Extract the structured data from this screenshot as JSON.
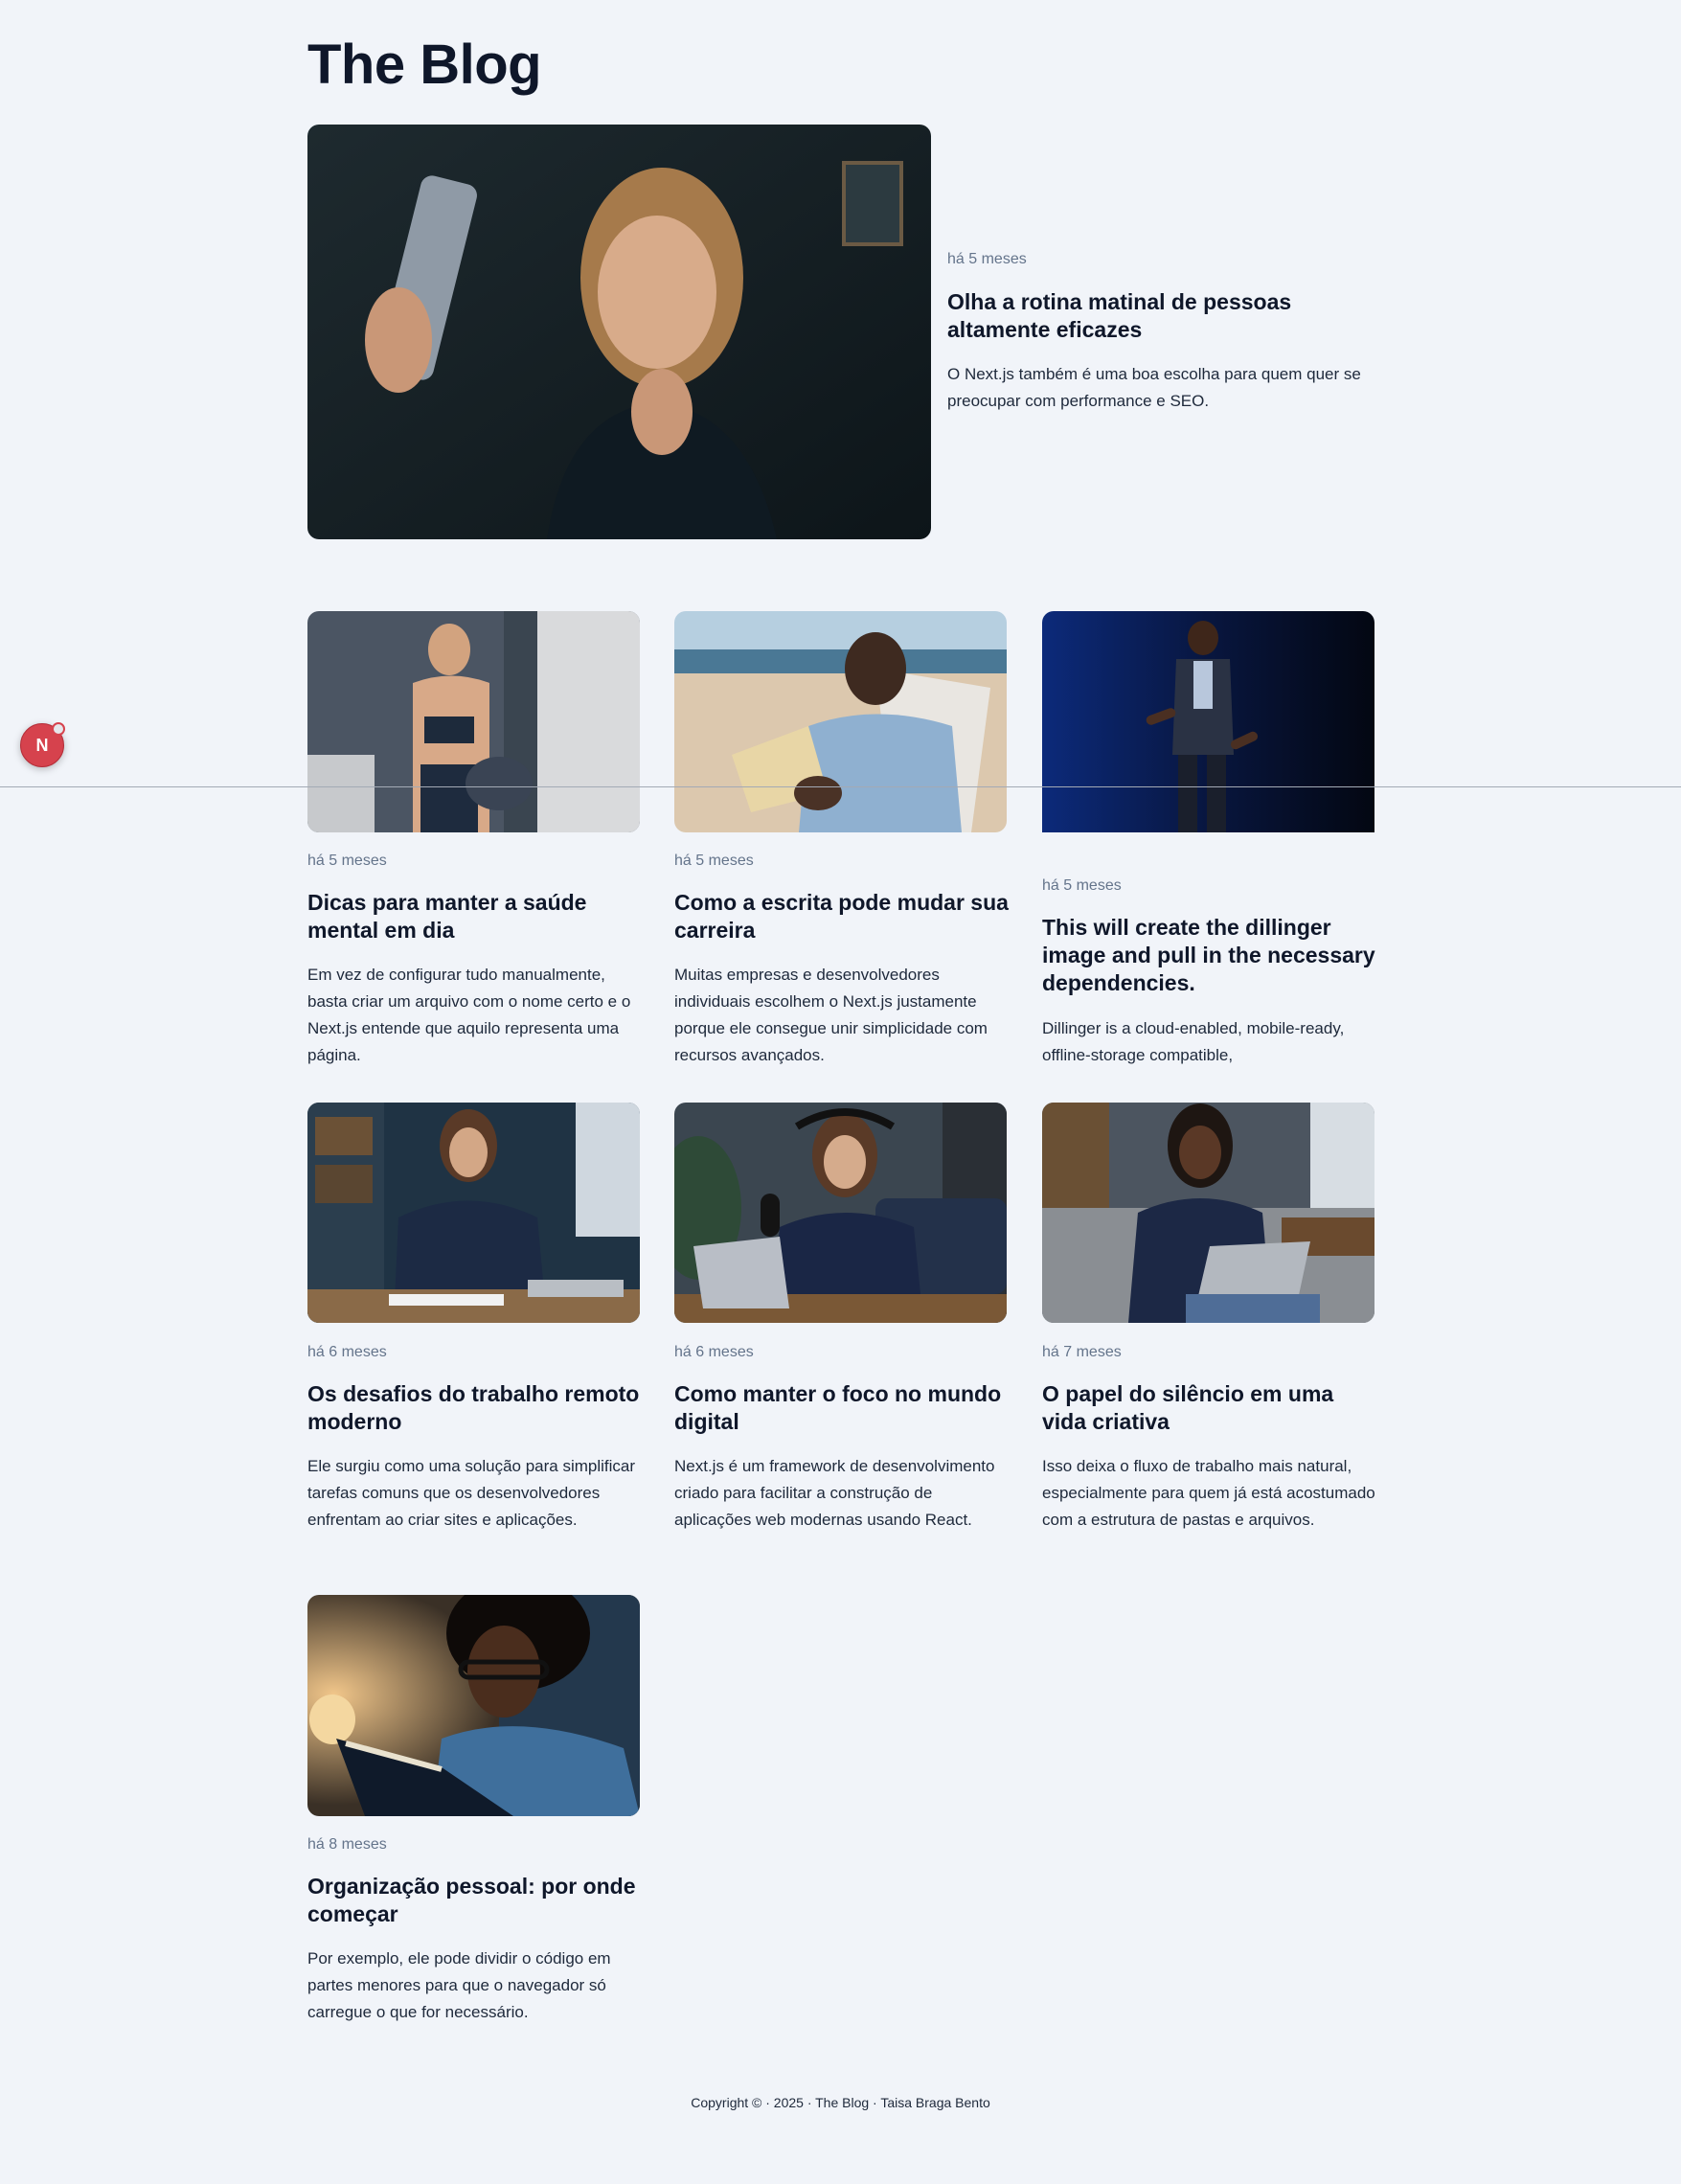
{
  "site": {
    "title": "The Blog"
  },
  "featured": {
    "time": "há 5 meses",
    "title": "Olha a rotina matinal de pessoas altamente eficazes",
    "excerpt": "O Next.js também é uma boa escolha para quem quer se preocupar com performance e SEO."
  },
  "posts": [
    {
      "time": "há 5 meses",
      "title": "Dicas para manter a saúde mental em dia",
      "excerpt": "Em vez de configurar tudo manualmente, basta criar um arquivo com o nome certo e o Next.js entende que aquilo representa uma página."
    },
    {
      "time": "há 5 meses",
      "title": "Como a escrita pode mudar sua carreira",
      "excerpt": "Muitas empresas e desenvolvedores individuais escolhem o Next.js justamente porque ele consegue unir simplicidade com recursos avançados."
    },
    {
      "time": "há 5 meses",
      "title": "This will create the dillinger image and pull in the necessary dependencies.",
      "excerpt": "Dillinger is a cloud-enabled, mobile-ready, offline-storage compatible,"
    },
    {
      "time": "há 6 meses",
      "title": "Os desafios do trabalho remoto moderno",
      "excerpt": "Ele surgiu como uma solução para simplificar tarefas comuns que os desenvolvedores enfrentam ao criar sites e aplicações."
    },
    {
      "time": "há 6 meses",
      "title": "Como manter o foco no mundo digital",
      "excerpt": "Next.js é um framework de desenvolvimento criado para facilitar a construção de aplicações web modernas usando React."
    },
    {
      "time": "há 7 meses",
      "title": "O papel do silêncio em uma vida criativa",
      "excerpt": "Isso deixa o fluxo de trabalho mais natural, especialmente para quem já está acostumado com a estrutura de pastas e arquivos."
    },
    {
      "time": "há 8 meses",
      "title": "Organização pessoal: por onde começar",
      "excerpt": "Por exemplo, ele pode dividir o código em partes menores para que o navegador só carregue o que for necessário."
    }
  ],
  "dev_badge": {
    "letter": "N",
    "color": "#d6424d"
  },
  "footer": {
    "text": "Copyright © · 2025 · The Blog · Taisa Braga Bento"
  }
}
